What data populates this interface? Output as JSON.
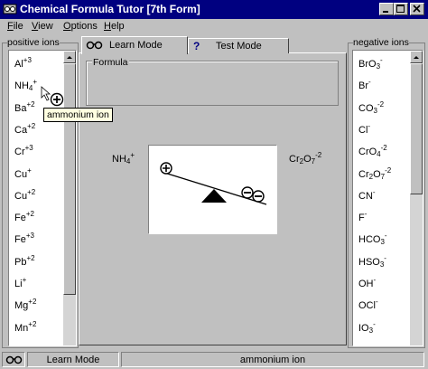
{
  "window": {
    "title": "Chemical Formula Tutor [7th Form]"
  },
  "menu": [
    {
      "label": "File",
      "accel": "F",
      "rest": "ile"
    },
    {
      "label": "View",
      "accel": "V",
      "rest": "iew"
    },
    {
      "label": "Options",
      "accel": "O",
      "rest": "ptions"
    },
    {
      "label": "Help",
      "accel": "H",
      "rest": "elp"
    }
  ],
  "positive_ions": {
    "label": "positive ions",
    "items": [
      {
        "base": "Al",
        "charge": "+3"
      },
      {
        "base": "NH",
        "sub": "4",
        "charge": "+"
      },
      {
        "base": "Ba",
        "charge": "+2"
      },
      {
        "base": "Ca",
        "charge": "+2"
      },
      {
        "base": "Cr",
        "charge": "+3"
      },
      {
        "base": "Cu",
        "charge": "+"
      },
      {
        "base": "Cu",
        "charge": "+2"
      },
      {
        "base": "Fe",
        "charge": "+2"
      },
      {
        "base": "Fe",
        "charge": "+3"
      },
      {
        "base": "Pb",
        "charge": "+2"
      },
      {
        "base": "Li",
        "charge": "+"
      },
      {
        "base": "Mg",
        "charge": "+2"
      },
      {
        "base": "Mn",
        "charge": "+2"
      }
    ]
  },
  "negative_ions": {
    "label": "negative ions",
    "items": [
      {
        "base": "BrO",
        "sub": "3",
        "charge": "-"
      },
      {
        "base": "Br",
        "charge": "-"
      },
      {
        "base": "CO",
        "sub": "3",
        "charge": "-2"
      },
      {
        "base": "Cl",
        "charge": "-"
      },
      {
        "base": "CrO",
        "sub": "4",
        "charge": "-2"
      },
      {
        "base": "Cr",
        "sub": "2",
        "mid": "O",
        "sub2": "7",
        "charge": "-2"
      },
      {
        "base": "CN",
        "charge": "-"
      },
      {
        "base": "F",
        "charge": "-"
      },
      {
        "base": "HCO",
        "sub": "3",
        "charge": "-"
      },
      {
        "base": "HSO",
        "sub": "3",
        "charge": "-"
      },
      {
        "base": "OH",
        "charge": "-"
      },
      {
        "base": "OCl",
        "charge": "-"
      },
      {
        "base": "IO",
        "sub": "3",
        "charge": "-"
      }
    ]
  },
  "tabs": [
    {
      "label": "Learn Mode",
      "icon": "glasses-icon",
      "active": true
    },
    {
      "label": "Test Mode",
      "icon": "question-icon",
      "active": false
    }
  ],
  "learn": {
    "formula_label": "Formula",
    "cation": {
      "base": "NH",
      "sub": "4",
      "charge": "+"
    },
    "anion": {
      "base": "Cr",
      "sub": "2",
      "mid": "O",
      "sub2": "7",
      "charge": "-2"
    }
  },
  "tooltip": "ammonium ion",
  "status": {
    "mode": "Learn Mode",
    "message": "ammonium ion"
  },
  "colors": {
    "titlebar": "#000080",
    "face": "#c0c0c0",
    "tooltip_bg": "#ffffe1"
  }
}
